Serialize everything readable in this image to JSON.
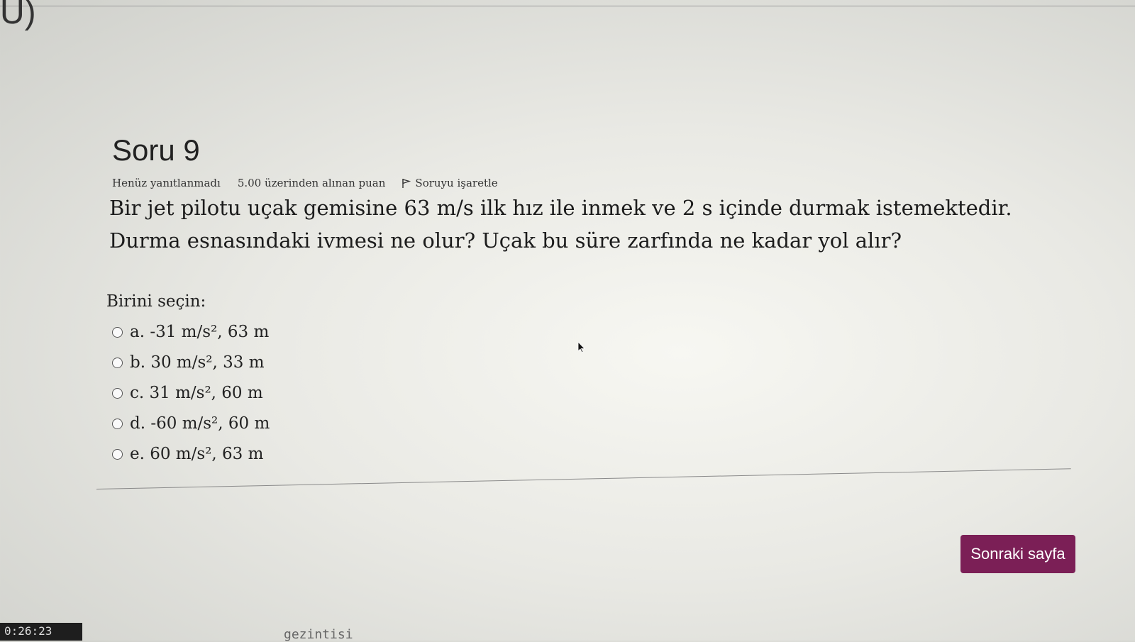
{
  "header": {
    "corner_glyph": "U)"
  },
  "question": {
    "title": "Soru 9",
    "status": "Henüz yanıtlanmadı",
    "grade": "5.00 üzerinden alınan puan",
    "flag_label": "Soruyu işaretle",
    "text": "Bir jet pilotu uçak gemisine 63 m/s ilk hız ile inmek ve 2 s içinde durmak istemektedir. Durma esnasındaki ivmesi ne olur? Uçak bu süre zarfında ne kadar yol alır?",
    "prompt": "Birini seçin:",
    "options": [
      {
        "label": "a. -31 m/s², 63 m"
      },
      {
        "label": "b. 30 m/s², 33 m"
      },
      {
        "label": "c. 31 m/s², 60 m"
      },
      {
        "label": "d. -60 m/s², 60 m"
      },
      {
        "label": "e. 60 m/s², 63 m"
      }
    ]
  },
  "footer": {
    "next_label": "Sonraki sayfa",
    "timer": "0:26:23",
    "nav_fragment": "gezintisi"
  },
  "colors": {
    "accent": "#7b1f56"
  },
  "icons": {
    "flag": "flag-icon",
    "cursor": "mouse-cursor-icon"
  }
}
